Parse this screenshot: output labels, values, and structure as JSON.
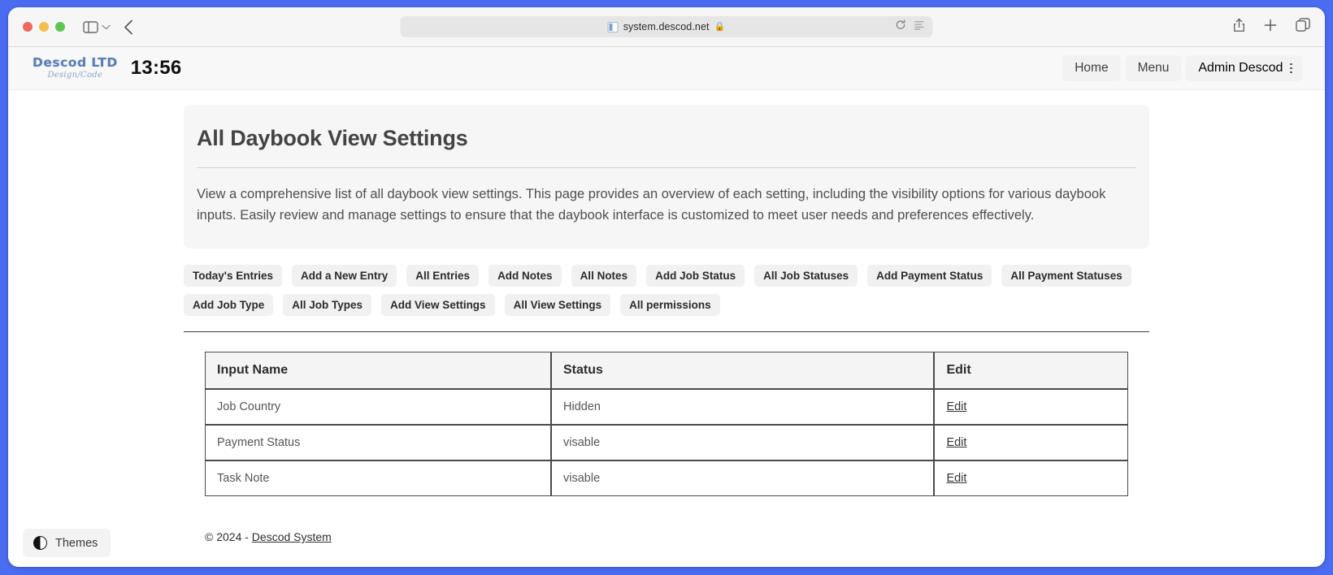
{
  "browser": {
    "traffic_lights": [
      "close",
      "minimize",
      "zoom"
    ],
    "sidebar_toggle_icon": "sidebar-icon",
    "chevron_icon": "chevron-down-icon",
    "back_icon": "back-arrow-icon",
    "url": "system.descod.net",
    "lock_icon": "lock-icon",
    "reload_icon": "reload-icon",
    "reader_icon": "reader-view-icon",
    "share_icon": "share-icon",
    "new_tab_icon": "plus-icon",
    "tabs_icon": "tab-overview-icon"
  },
  "header": {
    "logo_main": "Descod LTD",
    "logo_sub": "Design/Code",
    "clock": "13:56",
    "nav": [
      {
        "label": "Home"
      },
      {
        "label": "Menu"
      }
    ],
    "user": {
      "label": "Admin Descod",
      "menu_icon": "kebab-menu-icon"
    }
  },
  "jumbotron": {
    "title": "All Daybook View Settings",
    "description": "View a comprehensive list of all daybook view settings. This page provides an overview of each setting, including the visibility options for various daybook inputs. Easily review and manage settings to ensure that the daybook interface is customized to meet user needs and preferences effectively."
  },
  "quick_links": [
    {
      "label": "Today's Entries"
    },
    {
      "label": "Add a New Entry"
    },
    {
      "label": "All Entries"
    },
    {
      "label": "Add Notes"
    },
    {
      "label": "All Notes"
    },
    {
      "label": "Add Job Status"
    },
    {
      "label": "All Job Statuses"
    },
    {
      "label": "Add Payment Status"
    },
    {
      "label": "All Payment Statuses"
    },
    {
      "label": "Add Job Type"
    },
    {
      "label": "All Job Types"
    },
    {
      "label": "Add View Settings"
    },
    {
      "label": "All View Settings"
    },
    {
      "label": "All permissions"
    }
  ],
  "table": {
    "columns": [
      "Input Name",
      "Status",
      "Edit"
    ],
    "rows": [
      {
        "input_name": "Job Country",
        "status": "Hidden",
        "action": "Edit"
      },
      {
        "input_name": "Payment Status",
        "status": "visable",
        "action": "Edit"
      },
      {
        "input_name": "Task Note",
        "status": "visable",
        "action": "Edit"
      }
    ]
  },
  "footer": {
    "copyright_prefix": "© 2024 - ",
    "company_link": "Descod System"
  },
  "theme_switcher": {
    "label": "Themes",
    "icon": "contrast-circle-icon"
  },
  "colors": {
    "frame_blue": "#4a6cf0",
    "brand_blue": "#5b7fb5",
    "toolbar_gray": "#f6f6f6",
    "jumbotron_gray": "#f6f6f6",
    "pill_gray": "#f1f1f1",
    "table_border": "#4a4a4a"
  }
}
